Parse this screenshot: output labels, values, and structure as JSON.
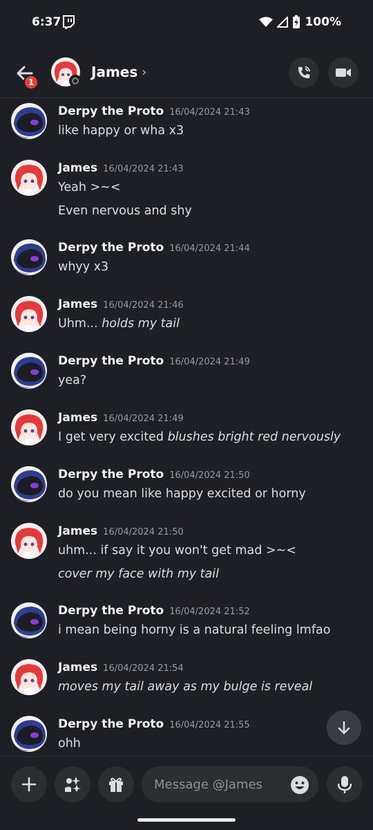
{
  "status_bar": {
    "time": "6:37",
    "battery": "100%"
  },
  "header": {
    "name": "James",
    "chevron": "›",
    "back_badge": "1"
  },
  "messages": [
    {
      "author": "Derpy the Proto",
      "avatar": "proto",
      "timestamp": "16/04/2024 21:43",
      "lines": [
        {
          "text": "like happy or wha x3",
          "italic": ""
        }
      ]
    },
    {
      "author": "James",
      "avatar": "james",
      "timestamp": "16/04/2024 21:43",
      "lines": [
        {
          "text": "Yeah >~<",
          "italic": ""
        },
        {
          "text": "Even nervous and shy",
          "italic": ""
        }
      ]
    },
    {
      "author": "Derpy the Proto",
      "avatar": "proto",
      "timestamp": "16/04/2024 21:44",
      "lines": [
        {
          "text": "whyy x3",
          "italic": ""
        }
      ]
    },
    {
      "author": "James",
      "avatar": "james",
      "timestamp": "16/04/2024 21:46",
      "lines": [
        {
          "text": "Uhm... ",
          "italic": "holds my tail"
        }
      ]
    },
    {
      "author": "Derpy the Proto",
      "avatar": "proto",
      "timestamp": "16/04/2024 21:49",
      "lines": [
        {
          "text": "yea?",
          "italic": ""
        }
      ]
    },
    {
      "author": "James",
      "avatar": "james",
      "timestamp": "16/04/2024 21:49",
      "lines": [
        {
          "text": "I get very excited ",
          "italic": "blushes bright red nervously"
        }
      ]
    },
    {
      "author": "Derpy the Proto",
      "avatar": "proto",
      "timestamp": "16/04/2024 21:50",
      "lines": [
        {
          "text": "do you mean like happy excited or horny",
          "italic": ""
        }
      ]
    },
    {
      "author": "James",
      "avatar": "james",
      "timestamp": "16/04/2024 21:50",
      "lines": [
        {
          "text": "uhm... if say it you won't get mad >~<",
          "italic": ""
        },
        {
          "text": "",
          "italic": "cover my face with my tail"
        }
      ]
    },
    {
      "author": "Derpy the Proto",
      "avatar": "proto",
      "timestamp": "16/04/2024 21:52",
      "lines": [
        {
          "text": "i mean being horny is a natural feeling lmfao",
          "italic": ""
        }
      ]
    },
    {
      "author": "James",
      "avatar": "james",
      "timestamp": "16/04/2024 21:54",
      "lines": [
        {
          "text": "",
          "italic": "moves my tail away as my bulge is reveal"
        }
      ]
    },
    {
      "author": "Derpy the Proto",
      "avatar": "proto",
      "timestamp": "16/04/2024 21:55",
      "lines": [
        {
          "text": "ohh",
          "italic": ""
        }
      ]
    }
  ],
  "composer": {
    "placeholder": "Message @James"
  },
  "icons": {
    "back": "back-arrow-icon",
    "call": "phone-call-icon",
    "video": "video-camera-icon",
    "add": "plus-icon",
    "apps": "apps-sparkle-icon",
    "gift": "gift-icon",
    "emoji": "emoji-icon",
    "mic": "microphone-icon",
    "scroll": "arrow-down-icon"
  },
  "colors": {
    "background": "#1e1f24",
    "button": "#2b2d31",
    "badge": "#e53c3c",
    "muted": "#949ba4"
  }
}
